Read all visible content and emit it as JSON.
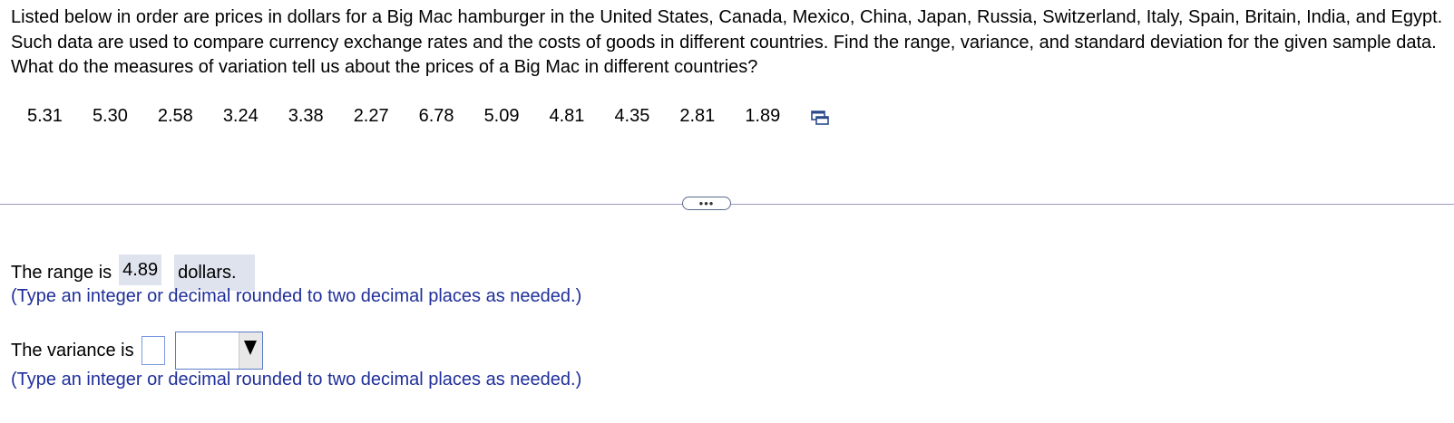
{
  "question": {
    "text": "Listed below in order are prices in dollars for a Big Mac hamburger in the United States, Canada, Mexico, China, Japan, Russia, Switzerland, Italy, Spain, Britain, India, and Egypt. Such data are used to compare currency exchange rates and the costs of goods in different countries. Find the range, variance, and standard deviation for the given sample data. What do the measures of variation tell us about the prices of a Big Mac in different countries?"
  },
  "data_values": [
    "5.31",
    "5.30",
    "2.58",
    "3.24",
    "3.38",
    "2.27",
    "6.78",
    "5.09",
    "4.81",
    "4.35",
    "2.81",
    "1.89"
  ],
  "icons": {
    "copy": "copy-data-icon",
    "more": "more-dots",
    "dropdown": "triangle-down-icon"
  },
  "more_button": {
    "label": "•••"
  },
  "range": {
    "prefix": "The range is",
    "value": "4.89",
    "unit": "dollars.",
    "hint": "(Type an integer or decimal rounded to two decimal places as needed.)"
  },
  "variance": {
    "prefix": "The variance is",
    "value": "",
    "unit_selected": "",
    "hint": "(Type an integer or decimal rounded to two decimal places as needed.)"
  },
  "colors": {
    "hint_text": "#1f2f9a",
    "filled_answer_bg": "#dfe3ee",
    "input_border": "#7a9ae0",
    "divider": "#9a9ac0"
  }
}
